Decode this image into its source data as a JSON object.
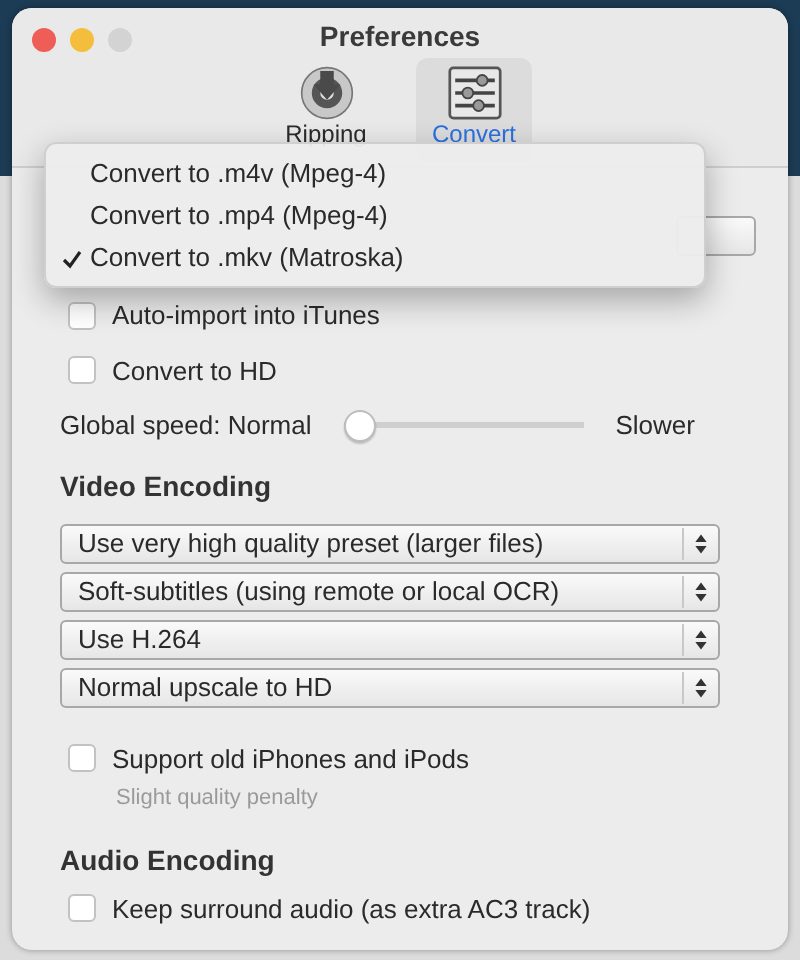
{
  "window": {
    "title": "Preferences"
  },
  "toolbar": [
    {
      "label": "Ripping",
      "selected": false,
      "kind": "disc"
    },
    {
      "label": "Convert",
      "selected": true,
      "kind": "sliders"
    }
  ],
  "format_menu": [
    {
      "label": "Convert to .m4v (Mpeg-4)",
      "checked": false
    },
    {
      "label": "Convert to .mp4 (Mpeg-4)",
      "checked": false
    },
    {
      "label": "Convert to .mkv (Matroska)",
      "checked": true
    }
  ],
  "options": [
    {
      "label": "Auto-import into iTunes",
      "checked": false
    },
    {
      "label": "Convert to HD",
      "checked": false
    }
  ],
  "speed": {
    "label": "Global speed: Normal",
    "level": 0,
    "end_label": "Slower"
  },
  "video_encoding": {
    "heading": "Video Encoding",
    "popups": [
      "Use very high quality preset (larger files)",
      "Soft-subtitles (using remote or local OCR)",
      "Use H.264",
      "Normal upscale to HD"
    ],
    "option": {
      "label": "Support old iPhones and iPods",
      "checked": false,
      "note": "Slight quality penalty"
    }
  },
  "audio_encoding": {
    "heading": "Audio Encoding",
    "option": {
      "label": "Keep surround audio (as extra AC3 track)",
      "checked": false
    }
  }
}
